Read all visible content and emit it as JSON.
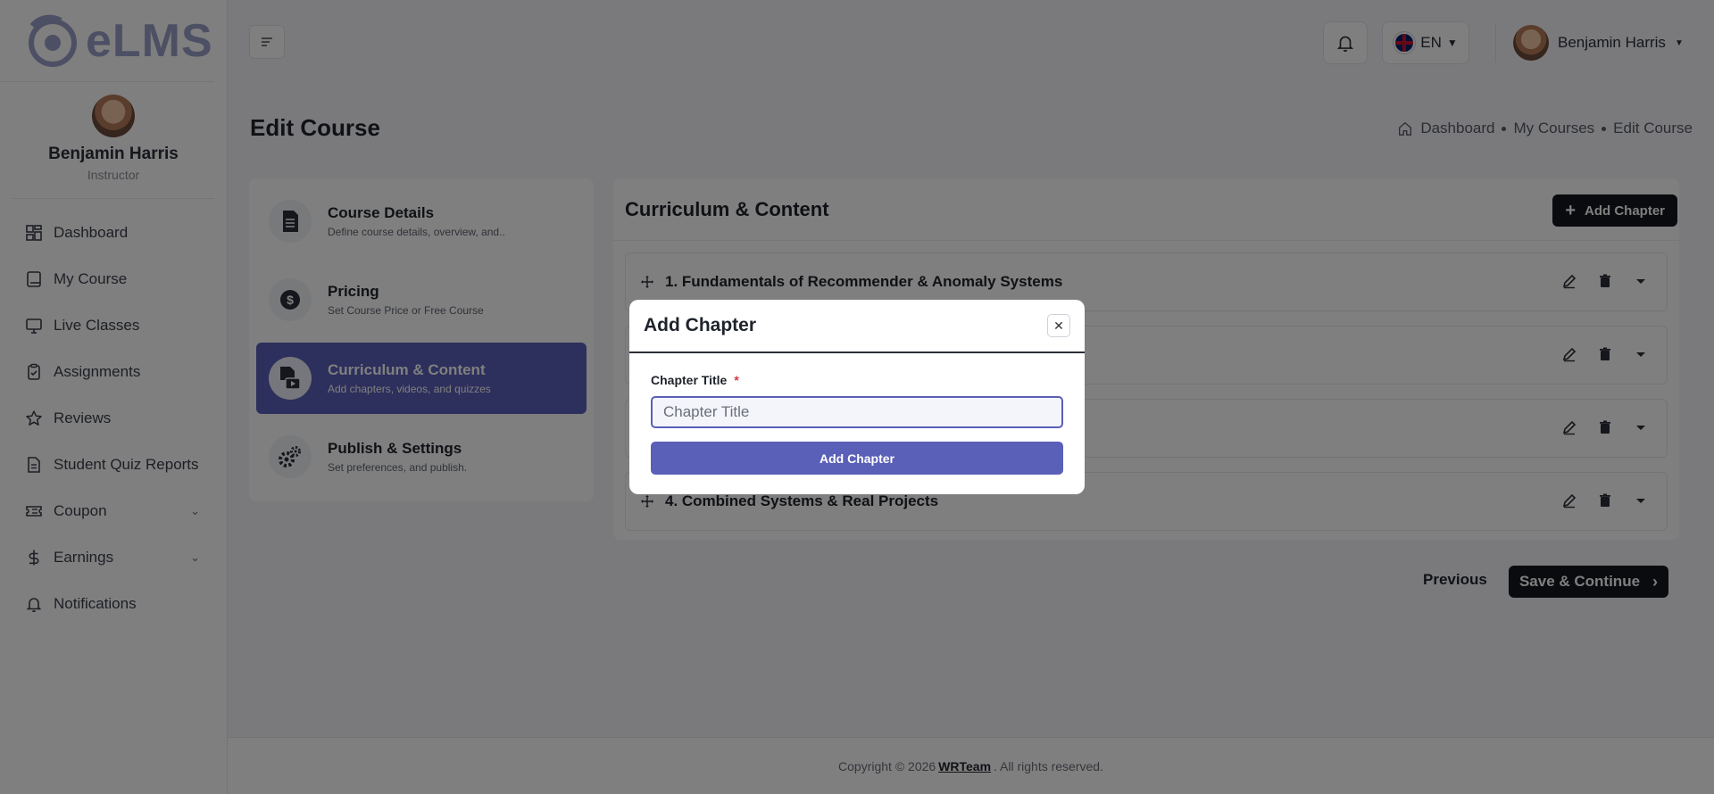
{
  "brand": {
    "logo_text": "eLMS"
  },
  "user": {
    "name": "Benjamin Harris",
    "role": "Instructor"
  },
  "sidebar": {
    "items": [
      {
        "label": "Dashboard",
        "icon": "dashboard-icon"
      },
      {
        "label": "My Course",
        "icon": "book-icon"
      },
      {
        "label": "Live Classes",
        "icon": "monitor-icon"
      },
      {
        "label": "Assignments",
        "icon": "assignment-icon"
      },
      {
        "label": "Reviews",
        "icon": "star-icon"
      },
      {
        "label": "Student Quiz Reports",
        "icon": "report-icon"
      },
      {
        "label": "Coupon",
        "icon": "coupon-icon",
        "has_chevron": true
      },
      {
        "label": "Earnings",
        "icon": "dollar-icon",
        "has_chevron": true
      },
      {
        "label": "Notifications",
        "icon": "bell-icon"
      }
    ]
  },
  "header": {
    "language": "EN",
    "user_name": "Benjamin Harris"
  },
  "page": {
    "title": "Edit Course",
    "breadcrumb": [
      "Dashboard",
      "My Courses",
      "Edit Course"
    ]
  },
  "steps": [
    {
      "title": "Course Details",
      "subtitle": "Define course details, overview, and..",
      "icon": "document-icon",
      "active": false
    },
    {
      "title": "Pricing",
      "subtitle": "Set Course Price or Free Course",
      "icon": "dollar-coin-icon",
      "active": false
    },
    {
      "title": "Curriculum & Content",
      "subtitle": "Add chapters, videos, and quizzes",
      "icon": "video-file-icon",
      "active": true
    },
    {
      "title": "Publish & Settings",
      "subtitle": "Set preferences, and publish.",
      "icon": "gears-icon",
      "active": false
    }
  ],
  "curriculum": {
    "title": "Curriculum & Content",
    "add_button": "Add Chapter",
    "chapters": [
      {
        "title": "1. Fundamentals of Recommender & Anomaly Systems"
      },
      {
        "title": ""
      },
      {
        "title": ""
      },
      {
        "title": "4. Combined Systems & Real Projects"
      }
    ]
  },
  "footer_nav": {
    "previous": "Previous",
    "save": "Save & Continue"
  },
  "footer": {
    "before": "Copyright © 2026",
    "link": "WRTeam",
    "after": ". All rights reserved."
  },
  "modal": {
    "title": "Add Chapter",
    "field_label": "Chapter Title",
    "required_mark": "*",
    "placeholder": "Chapter Title",
    "value": "",
    "submit": "Add Chapter"
  },
  "colors": {
    "accent": "#5a5fb8",
    "dark_button": "#15171c",
    "overlay": "rgba(0,0,0,0.5)"
  }
}
